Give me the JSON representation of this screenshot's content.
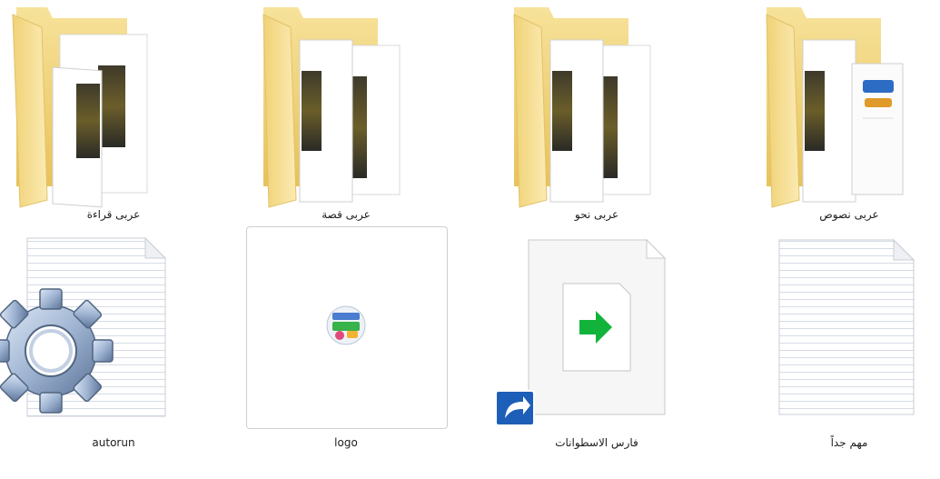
{
  "window": {
    "view": "extra-large-icons"
  },
  "items": [
    {
      "name": "عربى قراءة",
      "type": "folder",
      "icon": "folder-with-film-icon"
    },
    {
      "name": "عربى قصة",
      "type": "folder",
      "icon": "folder-with-film-icon"
    },
    {
      "name": "عربى نحو",
      "type": "folder",
      "icon": "folder-with-film-icon"
    },
    {
      "name": "عربى نصوص",
      "type": "folder",
      "icon": "folder-with-book-icon"
    },
    {
      "name": "autorun",
      "type": "setup-information",
      "icon": "gear-text-file-icon"
    },
    {
      "name": "logo",
      "type": "icon-file",
      "icon": "logo-image-icon"
    },
    {
      "name": "فارس الاسطوانات",
      "type": "shortcut",
      "icon": "shortcut-arrow-icon"
    },
    {
      "name": "مهم جداً",
      "type": "text-document",
      "icon": "text-document-icon"
    }
  ],
  "colors": {
    "folder_back": "#f3d77e",
    "folder_front": "#f7e3a0",
    "shortcut_arrow": "#12b33a",
    "shortcut_badge": "#1d5fb8",
    "gear": "#8fa7c9"
  }
}
